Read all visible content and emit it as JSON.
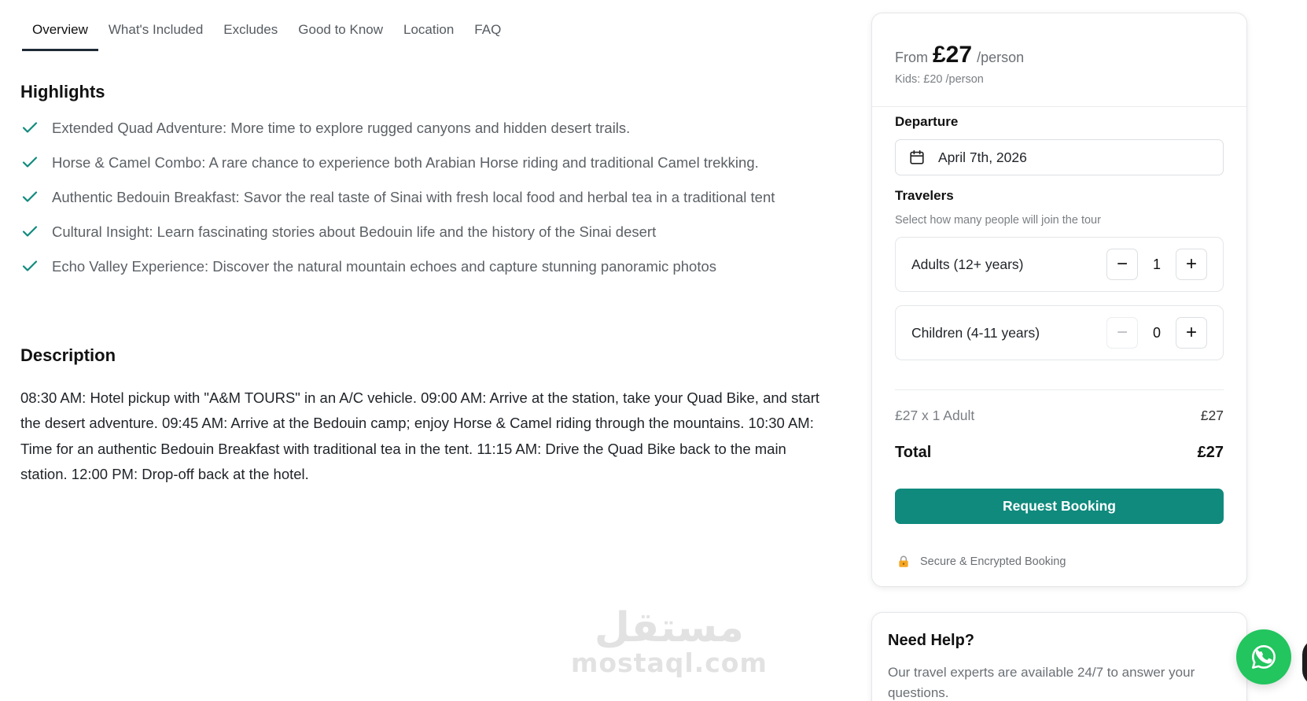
{
  "tabs": [
    {
      "label": "Overview",
      "active": true
    },
    {
      "label": "What's Included"
    },
    {
      "label": "Excludes"
    },
    {
      "label": "Good to Know"
    },
    {
      "label": "Location"
    },
    {
      "label": "FAQ"
    }
  ],
  "highlights": {
    "title": "Highlights",
    "items": [
      "Extended Quad Adventure: More time to explore rugged canyons and hidden desert trails.",
      "Horse & Camel Combo: A rare chance to experience both Arabian Horse riding and traditional Camel trekking.",
      "Authentic Bedouin Breakfast: Savor the real taste of Sinai with fresh local food and herbal tea in a traditional tent",
      "Cultural Insight: Learn fascinating stories about Bedouin life and the history of the Sinai desert",
      "Echo Valley Experience: Discover the natural mountain echoes and capture stunning panoramic photos"
    ]
  },
  "description": {
    "title": "Description",
    "text": "08:30 AM: Hotel pickup with \"A&M TOURS\" in an A/C vehicle. 09:00 AM: Arrive at the station, take your Quad Bike, and start the desert adventure. 09:45 AM: Arrive at the Bedouin camp; enjoy Horse & Camel riding through the mountains. 10:30 AM: Time for an authentic Bedouin Breakfast with traditional tea in the tent. 11:15 AM: Drive the Quad Bike back to the main station. 12:00 PM: Drop-off back at the hotel."
  },
  "watermark": {
    "arabic": "مستقل",
    "latin": "mostaql.com"
  },
  "booking": {
    "from_label": "From",
    "price": "£27",
    "per_label": "/person",
    "kids_price": "Kids: £20 /person",
    "departure_label": "Departure",
    "departure_date": "April 7th, 2026",
    "travelers_label": "Travelers",
    "travelers_sub": "Select how many people will join the tour",
    "adults_label": "Adults (12+ years)",
    "adults_count": "1",
    "children_label": "Children (4-11 years)",
    "children_count": "0",
    "minus_glyph": "−",
    "plus_glyph": "+",
    "line_item_label": "£27 x 1 Adult",
    "line_item_value": "£27",
    "total_label": "Total",
    "total_value": "£27",
    "button_label": "Request Booking",
    "secure_text": "Secure & Encrypted Booking"
  },
  "help": {
    "title": "Need Help?",
    "text": "Our travel experts are available 24/7 to answer your questions."
  },
  "colors": {
    "accent": "#0f8a7d",
    "whatsapp": "#22c55e",
    "check": "#0f8a7d"
  },
  "icons": [
    "check-icon",
    "calendar-icon",
    "lock-icon",
    "whatsapp-icon"
  ]
}
